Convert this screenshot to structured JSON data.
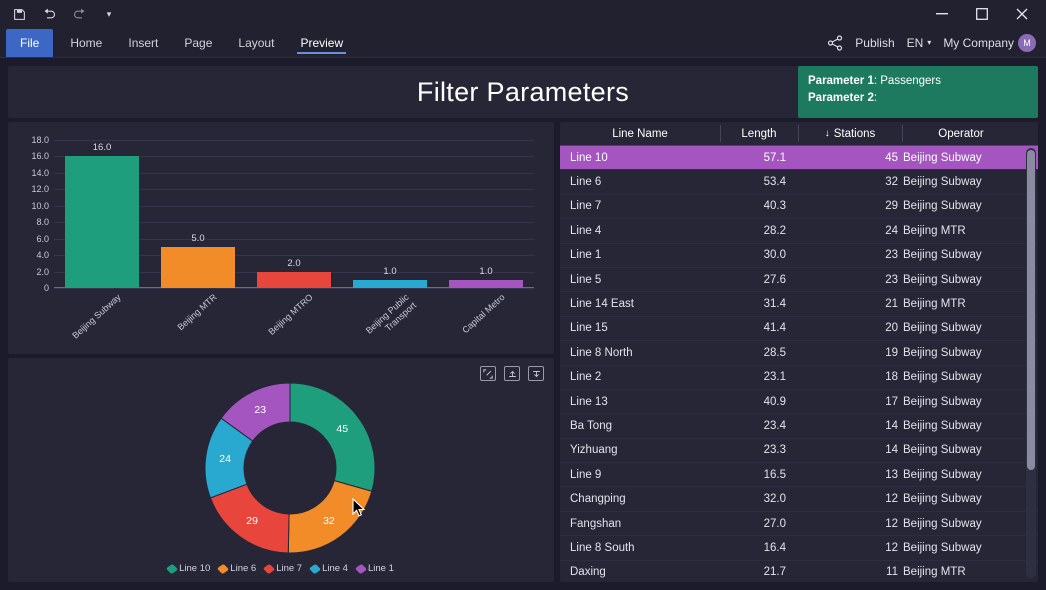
{
  "titlebar": {
    "icons": [
      "save-icon",
      "undo-icon",
      "redo-icon",
      "customize-icon"
    ],
    "window_buttons": {
      "minimize": "—",
      "maximize": "☐",
      "close": "✕"
    }
  },
  "ribbon": {
    "file_label": "File",
    "tabs": [
      {
        "label": "Home",
        "active": false
      },
      {
        "label": "Insert",
        "active": false
      },
      {
        "label": "Page",
        "active": false
      },
      {
        "label": "Layout",
        "active": false
      },
      {
        "label": "Preview",
        "active": true
      }
    ],
    "share_icon": "share-icon",
    "publish_label": "Publish",
    "language_label": "EN",
    "company_label": "My Company",
    "avatar_initial": "M"
  },
  "header": {
    "title": "Filter Parameters",
    "parameter_card": {
      "rows": [
        {
          "key": "Parameter 1",
          "value": "Passengers"
        },
        {
          "key": "Parameter 2",
          "value": ""
        }
      ],
      "color": "#1e7a5e"
    }
  },
  "chart_data": [
    {
      "type": "bar",
      "title": "",
      "xlabel": "",
      "ylabel": "",
      "ylim": [
        0,
        18
      ],
      "yticks": [
        "0",
        "2.0",
        "4.0",
        "6.0",
        "8.0",
        "10.0",
        "12.0",
        "14.0",
        "16.0",
        "18.0"
      ],
      "grid": true,
      "categories": [
        "Beijing Subway",
        "Beijing MTR",
        "Beijing MTRO",
        "Beijing Public Transport",
        "Capital Metro"
      ],
      "values": [
        16.0,
        5.0,
        2.0,
        1.0,
        1.0
      ],
      "value_labels": [
        "16.0",
        "5.0",
        "2.0",
        "1.0",
        "1.0"
      ],
      "colors": [
        "#1f9e7e",
        "#f28c28",
        "#e8453c",
        "#29a8d0",
        "#a455c0"
      ]
    },
    {
      "type": "pie",
      "subtype": "donut",
      "title": "",
      "labels": [
        "Line 10",
        "Line 6",
        "Line 7",
        "Line 4",
        "Line 1"
      ],
      "values": [
        45,
        32,
        29,
        24,
        23
      ],
      "value_labels": [
        "45",
        "32",
        "29",
        "24",
        "23"
      ],
      "colors": [
        "#1f9e7e",
        "#f28c28",
        "#e8453c",
        "#29a8d0",
        "#a455c0"
      ],
      "legend_position": "bottom",
      "toolbar_icons": [
        "focus-mode-icon",
        "drill-up-icon",
        "drill-down-icon"
      ]
    }
  ],
  "table": {
    "columns": [
      "Line Name",
      "Length",
      "Stations",
      "Operator"
    ],
    "sort_column": "Stations",
    "sort_indicator": "↓",
    "selected_row_index": 0,
    "rows": [
      {
        "name": "Line 10",
        "length": "57.1",
        "stations": "45",
        "operator": "Beijing Subway"
      },
      {
        "name": "Line 6",
        "length": "53.4",
        "stations": "32",
        "operator": "Beijing Subway"
      },
      {
        "name": "Line 7",
        "length": "40.3",
        "stations": "29",
        "operator": "Beijing Subway"
      },
      {
        "name": "Line 4",
        "length": "28.2",
        "stations": "24",
        "operator": "Beijing MTR"
      },
      {
        "name": "Line 1",
        "length": "30.0",
        "stations": "23",
        "operator": "Beijing Subway"
      },
      {
        "name": "Line 5",
        "length": "27.6",
        "stations": "23",
        "operator": "Beijing Subway"
      },
      {
        "name": "Line 14 East",
        "length": "31.4",
        "stations": "21",
        "operator": "Beijing MTR"
      },
      {
        "name": "Line 15",
        "length": "41.4",
        "stations": "20",
        "operator": "Beijing Subway"
      },
      {
        "name": "Line 8 North",
        "length": "28.5",
        "stations": "19",
        "operator": "Beijing Subway"
      },
      {
        "name": "Line 2",
        "length": "23.1",
        "stations": "18",
        "operator": "Beijing Subway"
      },
      {
        "name": "Line 13",
        "length": "40.9",
        "stations": "17",
        "operator": "Beijing Subway"
      },
      {
        "name": "Ba Tong",
        "length": "23.4",
        "stations": "14",
        "operator": "Beijing Subway"
      },
      {
        "name": "Yizhuang",
        "length": "23.3",
        "stations": "14",
        "operator": "Beijing Subway"
      },
      {
        "name": "Line 9",
        "length": "16.5",
        "stations": "13",
        "operator": "Beijing Subway"
      },
      {
        "name": "Changping",
        "length": "32.0",
        "stations": "12",
        "operator": "Beijing Subway"
      },
      {
        "name": "Fangshan",
        "length": "27.0",
        "stations": "12",
        "operator": "Beijing Subway"
      },
      {
        "name": "Line 8 South",
        "length": "16.4",
        "stations": "12",
        "operator": "Beijing Subway"
      },
      {
        "name": "Daxing",
        "length": "21.7",
        "stations": "11",
        "operator": "Beijing MTR"
      }
    ]
  }
}
